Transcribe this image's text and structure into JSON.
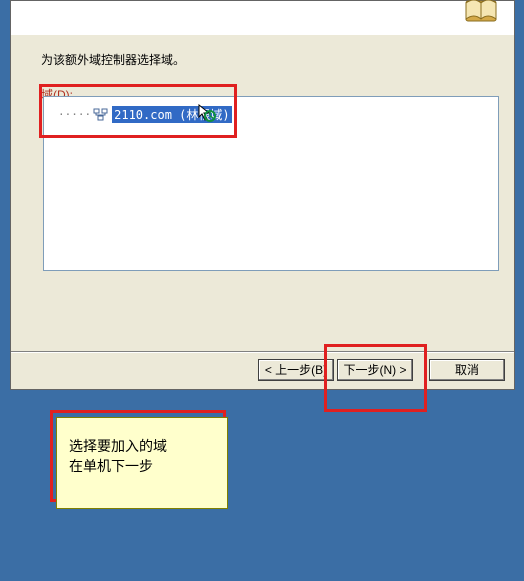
{
  "dialog": {
    "instruction": "为该额外域控制器选择域。",
    "field_label": "域(D):",
    "domain_entry": "2110.com (林根域)",
    "buttons": {
      "back": "< 上一步(B)",
      "next": "下一步(N) >",
      "cancel": "取消"
    }
  },
  "note": {
    "line1": "选择要加入的域",
    "line2": "在单机下一步"
  }
}
